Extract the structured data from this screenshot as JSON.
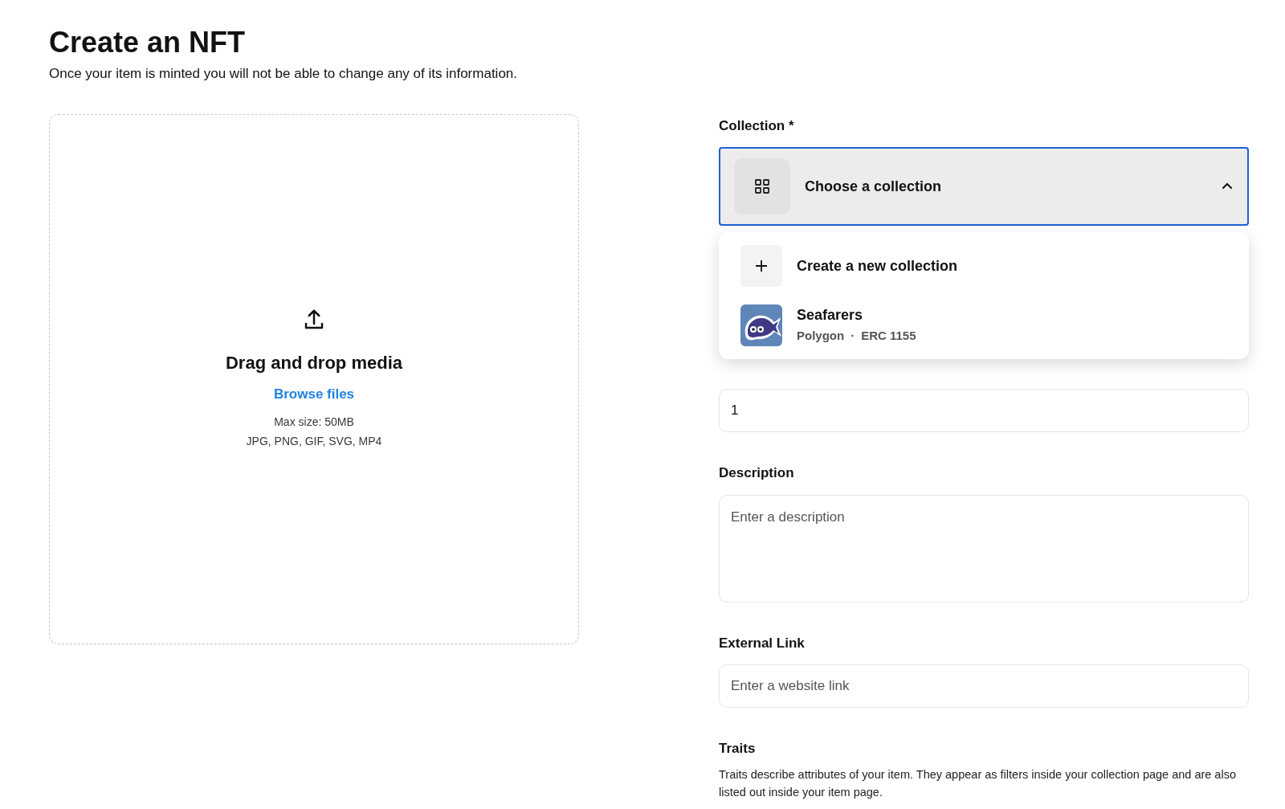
{
  "page": {
    "title": "Create an NFT",
    "subtitle": "Once your item is minted you will not be able to change any of its information."
  },
  "upload": {
    "heading": "Drag and drop media",
    "link": "Browse files",
    "max_size": "Max size: 50MB",
    "formats": "JPG, PNG, GIF, SVG, MP4"
  },
  "collection": {
    "label": "Collection *",
    "placeholder": "Choose a collection",
    "expanded": true,
    "menu": [
      {
        "kind": "create",
        "title": "Create a new collection"
      },
      {
        "kind": "collection",
        "title": "Seafarers",
        "chain": "Polygon",
        "separator": "·",
        "standard": "ERC 1155"
      }
    ]
  },
  "supply_field": {
    "value": "1"
  },
  "description": {
    "label": "Description",
    "placeholder": "Enter a description"
  },
  "external_link": {
    "label": "External Link",
    "placeholder": "Enter a website link"
  },
  "traits": {
    "label": "Traits",
    "text": "Traits describe attributes of your item. They appear as filters inside your collection page and are also listed out inside your item page."
  }
}
